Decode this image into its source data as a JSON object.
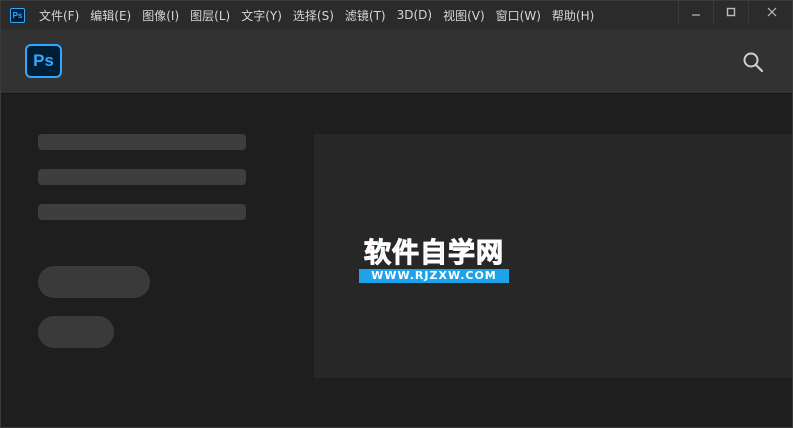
{
  "app_icon": {
    "text": "Ps"
  },
  "menu": {
    "items": [
      "文件(F)",
      "编辑(E)",
      "图像(I)",
      "图层(L)",
      "文字(Y)",
      "选择(S)",
      "滤镜(T)",
      "3D(D)",
      "视图(V)",
      "窗口(W)",
      "帮助(H)"
    ]
  },
  "window_controls": {
    "minimize_icon": "minimize-icon",
    "maximize_icon": "maximize-icon",
    "close_icon": "close-icon"
  },
  "header": {
    "logo_text": "Ps",
    "search_icon": "search-icon"
  },
  "colors": {
    "accent": "#31a8ff",
    "logo_bg": "#001e36",
    "watermark": "#1fa3e8"
  },
  "watermark": {
    "title": "软件自学网",
    "url": "WWW.RJZXW.COM"
  }
}
